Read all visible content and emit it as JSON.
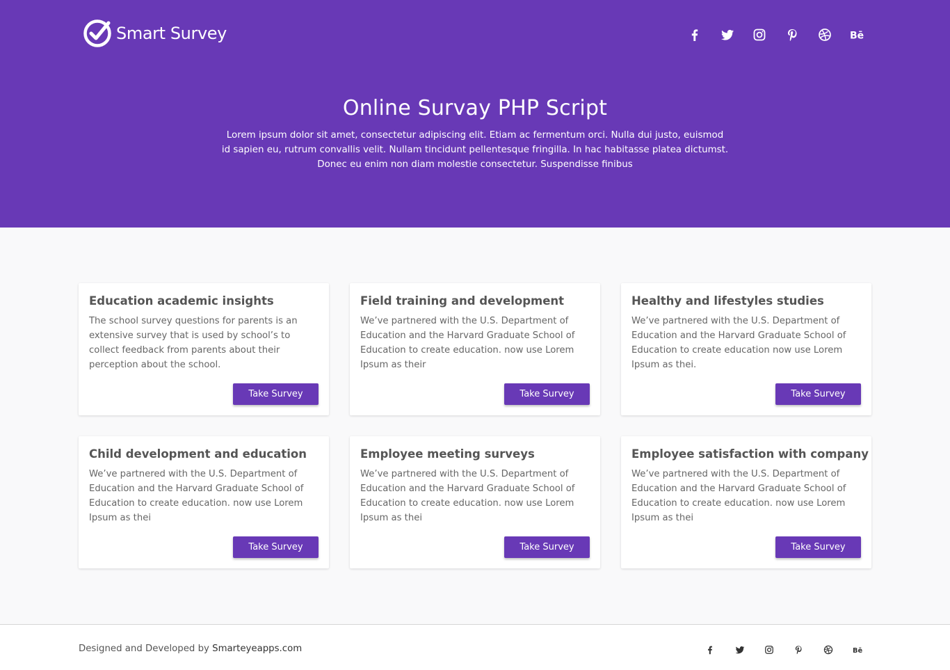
{
  "brand": {
    "name": "Smart Survey"
  },
  "header": {
    "social_icons": [
      "facebook-icon",
      "twitter-icon",
      "instagram-icon",
      "pinterest-icon",
      "dribbble-icon",
      "behance-icon"
    ]
  },
  "hero": {
    "title": "Online Survay PHP Script",
    "description": "Lorem ipsum dolor sit amet, consectetur adipiscing elit. Etiam ac fermentum orci. Nulla dui justo, euismod id sapien eu, rutrum convallis velit. Nullam tincidunt pellentesque fringilla. In hac habitasse platea dictumst. Donec eu enim non diam molestie consectetur. Suspendisse finibus"
  },
  "surveys": [
    {
      "title": "Education academic insights",
      "text": "The school survey questions for parents is an extensive survey that is used by school’s to collect feedback from parents about their perception about the school.",
      "button": "Take Survey"
    },
    {
      "title": "Field training and development",
      "text": "We’ve partnered with the U.S. Department of Education and the Harvard Graduate School of Education to create education. now use Lorem Ipsum as their",
      "button": "Take Survey"
    },
    {
      "title": "Healthy and lifestyles studies",
      "text": "We’ve partnered with the U.S. Department of Education and the Harvard Graduate School of Education to create education now use Lorem Ipsum as thei.",
      "button": "Take Survey"
    },
    {
      "title": "Child development and education",
      "text": "We’ve partnered with the U.S. Department of Education and the Harvard Graduate School of Education to create education. now use Lorem Ipsum as thei",
      "button": "Take Survey"
    },
    {
      "title": "Employee meeting surveys",
      "text": "We’ve partnered with the U.S. Department of Education and the Harvard Graduate School of Education to create education. now use Lorem Ipsum as thei",
      "button": "Take Survey"
    },
    {
      "title": "Employee satisfaction with company",
      "text": "We’ve partnered with the U.S. Department of Education and the Harvard Graduate School of Education to create education. now use Lorem Ipsum as thei",
      "button": "Take Survey"
    }
  ],
  "footer": {
    "credit_prefix": "Designed and Developed by ",
    "credit_link": "Smarteyeapps.com",
    "social_icons": [
      "facebook-icon",
      "twitter-icon",
      "instagram-icon",
      "pinterest-icon",
      "dribbble-icon",
      "behance-icon"
    ]
  },
  "colors": {
    "brand_purple": "#6839b6",
    "page_bg": "#f9f9fa",
    "card_bg": "#ffffff",
    "footer_icon": "#333333"
  }
}
